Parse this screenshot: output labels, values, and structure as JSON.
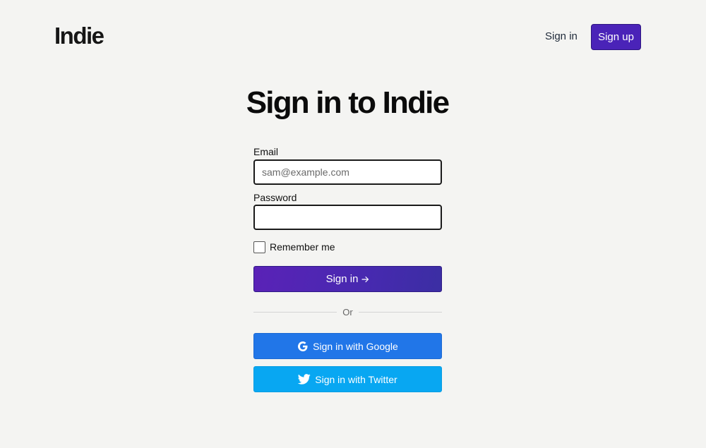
{
  "header": {
    "logo": "Indie",
    "signin_label": "Sign in",
    "signup_label": "Sign up"
  },
  "form": {
    "title": "Sign in to Indie",
    "email_label": "Email",
    "email_placeholder": "sam@example.com",
    "email_value": "",
    "password_label": "Password",
    "password_value": "",
    "remember_label": "Remember me",
    "remember_checked": false,
    "submit_label": "Sign in",
    "submit_icon": "arrow-right-icon",
    "divider_text": "Or",
    "google_label": "Sign in with Google",
    "google_icon": "google-icon",
    "twitter_label": "Sign in with Twitter",
    "twitter_icon": "twitter-icon"
  },
  "colors": {
    "background": "#f4f4f2",
    "primary": "#4a23b8",
    "google": "#2176e8",
    "twitter": "#08a7f2"
  }
}
